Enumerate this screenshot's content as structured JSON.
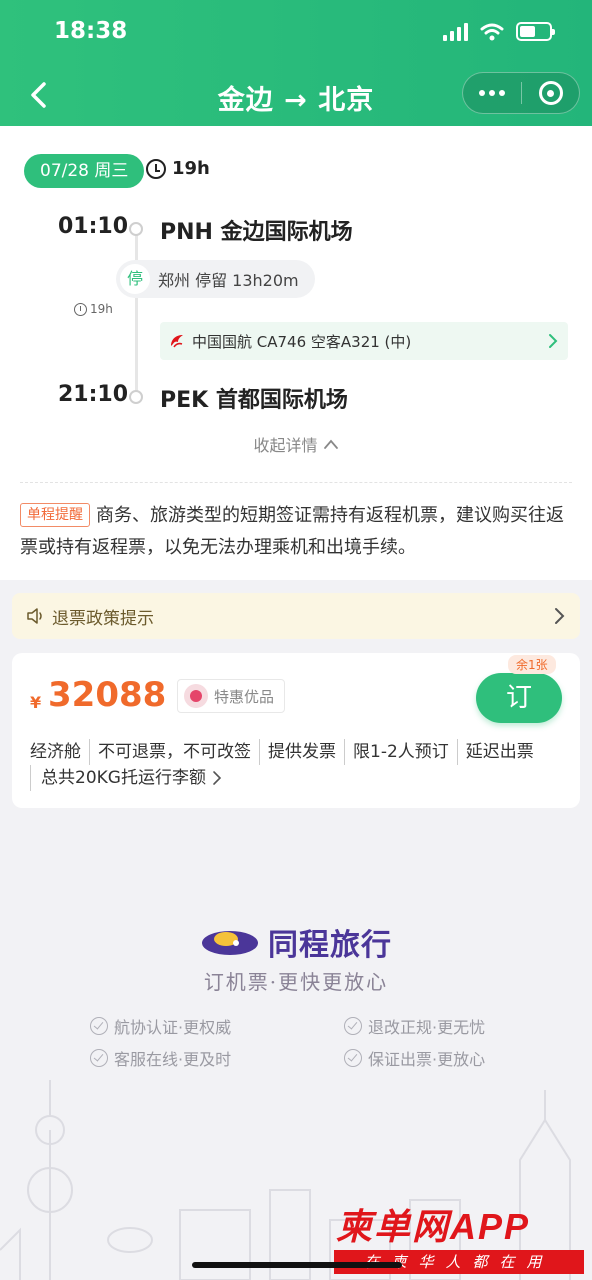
{
  "status_bar": {
    "time": "18:38"
  },
  "nav": {
    "title": "金边 → 北京"
  },
  "flight": {
    "date": "07/28 周三",
    "total_duration": "19h",
    "departure": {
      "time": "01:10",
      "airport": "PNH 金边国际机场"
    },
    "stop": {
      "badge": "停",
      "text": "郑州 停留 13h20m"
    },
    "side_duration": "19h",
    "airline_info": "中国国航 CA746  空客A321 (中)",
    "arrival": {
      "time": "21:10",
      "airport": "PEK 首都国际机场"
    },
    "collapse_label": "收起详情"
  },
  "notice": {
    "badge": "单程提醒",
    "text": "商务、旅游类型的短期签证需持有返程机票，建议购买往返票或持有返程票，以免无法办理乘机和出境手续。"
  },
  "refund": {
    "label": "退票政策提示"
  },
  "offer": {
    "currency": "¥",
    "price": "32088",
    "promo_label": "特惠优品",
    "remaining": "余1张",
    "book_label": "订",
    "tags": [
      "经济舱",
      "不可退票，不可改签",
      "提供发票",
      "限1-2人预订",
      "延迟出票"
    ],
    "baggage": "总共20KG托运行李额"
  },
  "brand": {
    "name": "同程旅行",
    "slogan": "订机票·更快更放心",
    "features": [
      "航协认证·更权威",
      "退改正规·更无忧",
      "客服在线·更及时",
      "保证出票·更放心"
    ]
  },
  "watermark": {
    "main": "柬单网APP",
    "sub": "在柬华人都在用"
  },
  "colors": {
    "primary": "#2fbf7c",
    "price": "#f06a2b",
    "brand": "#4b3699",
    "watermark": "#e0161b"
  }
}
